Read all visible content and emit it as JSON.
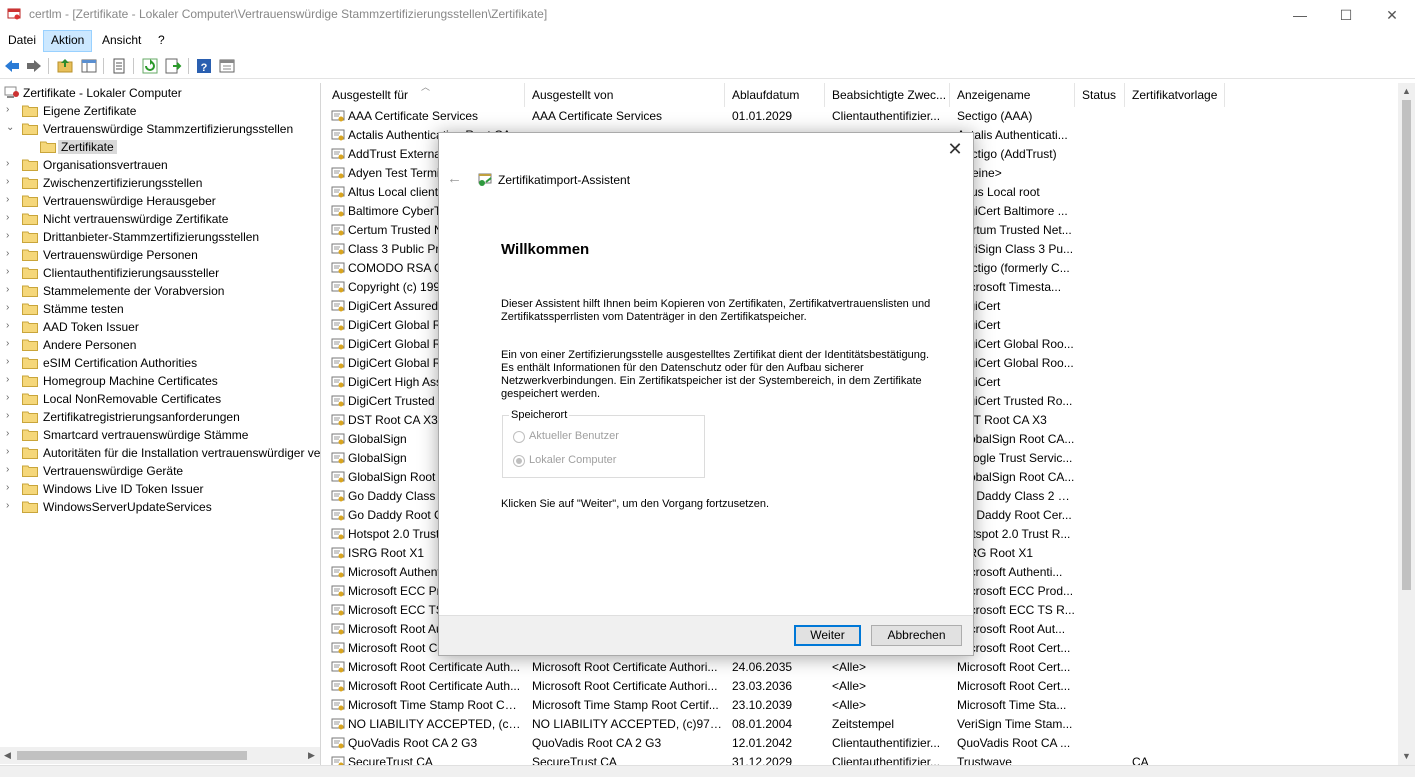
{
  "window": {
    "title": "certlm - [Zertifikate - Lokaler Computer\\Vertrauenswürdige Stammzertifizierungsstellen\\Zertifikate]",
    "minimize": "—",
    "maximize": "☐",
    "close": "✕"
  },
  "menu": [
    "Datei",
    "Aktion",
    "Ansicht",
    "?"
  ],
  "tree": {
    "root": "Zertifikate - Lokaler Computer",
    "items": [
      {
        "label": "Eigene Zertifikate",
        "level": 1,
        "expanded": false
      },
      {
        "label": "Vertrauenswürdige Stammzertifizierungsstellen",
        "level": 1,
        "expanded": true
      },
      {
        "label": "Zertifikate",
        "level": 2,
        "selected": true
      },
      {
        "label": "Organisationsvertrauen",
        "level": 1
      },
      {
        "label": "Zwischenzertifizierungsstellen",
        "level": 1
      },
      {
        "label": "Vertrauenswürdige Herausgeber",
        "level": 1
      },
      {
        "label": "Nicht vertrauenswürdige Zertifikate",
        "level": 1
      },
      {
        "label": "Drittanbieter-Stammzertifizierungsstellen",
        "level": 1
      },
      {
        "label": "Vertrauenswürdige Personen",
        "level": 1
      },
      {
        "label": "Clientauthentifizierungsaussteller",
        "level": 1
      },
      {
        "label": "Stammelemente der Vorabversion",
        "level": 1
      },
      {
        "label": "Stämme testen",
        "level": 1
      },
      {
        "label": "AAD Token Issuer",
        "level": 1
      },
      {
        "label": "Andere Personen",
        "level": 1
      },
      {
        "label": "eSIM Certification Authorities",
        "level": 1
      },
      {
        "label": "Homegroup Machine Certificates",
        "level": 1
      },
      {
        "label": "Local NonRemovable Certificates",
        "level": 1
      },
      {
        "label": "Zertifikatregistrierungsanforderungen",
        "level": 1
      },
      {
        "label": "Smartcard vertrauenswürdige Stämme",
        "level": 1
      },
      {
        "label": "Autoritäten für die Installation vertrauenswürdiger ve",
        "level": 1
      },
      {
        "label": "Vertrauenswürdige Geräte",
        "level": 1
      },
      {
        "label": "Windows Live ID Token Issuer",
        "level": 1
      },
      {
        "label": "WindowsServerUpdateServices",
        "level": 1
      }
    ]
  },
  "columns": [
    "Ausgestellt für",
    "Ausgestellt von",
    "Ablaufdatum",
    "Beabsichtigte Zwec...",
    "Anzeigename",
    "Status",
    "Zertifikatvorlage"
  ],
  "rows": [
    [
      "AAA Certificate Services",
      "AAA Certificate Services",
      "01.01.2029",
      "Clientauthentifizier...",
      "Sectigo (AAA)",
      "",
      ""
    ],
    [
      "Actalis Authentication Root CA",
      "",
      "",
      "",
      "Actalis Authenticati...",
      "",
      ""
    ],
    [
      "AddTrust External CA Root",
      "",
      "",
      "",
      "Sectigo (AddTrust)",
      "",
      ""
    ],
    [
      "Adyen Test Terminal",
      "",
      "",
      "",
      "<Keine>",
      "",
      ""
    ],
    [
      "Altus Local client",
      "",
      "",
      "",
      "Altus Local root",
      "",
      ""
    ],
    [
      "Baltimore CyberTrust",
      "",
      "",
      "",
      "DigiCert Baltimore ...",
      "",
      ""
    ],
    [
      "Certum Trusted Network",
      "",
      "",
      "",
      "Certum Trusted Net...",
      "",
      ""
    ],
    [
      "Class 3 Public Primary",
      "",
      "",
      "",
      "VeriSign Class 3 Pu...",
      "",
      ""
    ],
    [
      "COMODO RSA Certification",
      "",
      "",
      "",
      "Sectigo (formerly C...",
      "",
      ""
    ],
    [
      "Copyright (c) 1997",
      "",
      "",
      "",
      "Microsoft Timesta...",
      "",
      ""
    ],
    [
      "DigiCert Assured",
      "",
      "",
      "",
      "DigiCert",
      "",
      ""
    ],
    [
      "DigiCert Global Root",
      "",
      "",
      "",
      "DigiCert",
      "",
      ""
    ],
    [
      "DigiCert Global Root",
      "",
      "",
      "",
      "DigiCert Global Roo...",
      "",
      ""
    ],
    [
      "DigiCert Global Root",
      "",
      "",
      "",
      "DigiCert Global Roo...",
      "",
      ""
    ],
    [
      "DigiCert High Assurance",
      "",
      "",
      "",
      "DigiCert",
      "",
      ""
    ],
    [
      "DigiCert Trusted Root",
      "",
      "",
      "",
      "DigiCert Trusted Ro...",
      "",
      ""
    ],
    [
      "DST Root CA X3",
      "",
      "",
      "",
      "DST Root CA X3",
      "",
      ""
    ],
    [
      "GlobalSign",
      "",
      "",
      "",
      "GlobalSign Root CA...",
      "",
      ""
    ],
    [
      "GlobalSign",
      "",
      "",
      "",
      "Google Trust Servic...",
      "",
      ""
    ],
    [
      "GlobalSign Root CA",
      "",
      "",
      "",
      "GlobalSign Root CA...",
      "",
      ""
    ],
    [
      "Go Daddy Class 2",
      "",
      "",
      "",
      "Go Daddy Class 2 C...",
      "",
      ""
    ],
    [
      "Go Daddy Root Certificate",
      "",
      "",
      "",
      "Go Daddy Root Cer...",
      "",
      ""
    ],
    [
      "Hotspot 2.0 Trust",
      "",
      "",
      "",
      "Hotspot 2.0 Trust R...",
      "",
      ""
    ],
    [
      "ISRG Root X1",
      "",
      "",
      "",
      "ISRG Root X1",
      "",
      ""
    ],
    [
      "Microsoft Authenticode",
      "",
      "",
      "",
      "Microsoft Authenti...",
      "",
      ""
    ],
    [
      "Microsoft ECC Product",
      "",
      "",
      "",
      "Microsoft ECC Prod...",
      "",
      ""
    ],
    [
      "Microsoft ECC TS",
      "",
      "",
      "",
      "Microsoft ECC TS R...",
      "",
      ""
    ],
    [
      "Microsoft Root Authority",
      "",
      "",
      "",
      "Microsoft Root Aut...",
      "",
      ""
    ],
    [
      "Microsoft Root Certificate",
      "",
      "",
      "",
      "Microsoft Root Cert...",
      "",
      ""
    ],
    [
      "Microsoft Root Certificate Auth...",
      "Microsoft Root Certificate Authori...",
      "24.06.2035",
      "<Alle>",
      "Microsoft Root Cert...",
      "",
      ""
    ],
    [
      "Microsoft Root Certificate Auth...",
      "Microsoft Root Certificate Authori...",
      "23.03.2036",
      "<Alle>",
      "Microsoft Root Cert...",
      "",
      ""
    ],
    [
      "Microsoft Time Stamp Root Cer...",
      "Microsoft Time Stamp Root Certif...",
      "23.10.2039",
      "<Alle>",
      "Microsoft Time Sta...",
      "",
      ""
    ],
    [
      "NO LIABILITY ACCEPTED, (c)97 ...",
      "NO LIABILITY ACCEPTED, (c)97 Ve...",
      "08.01.2004",
      "Zeitstempel",
      "VeriSign Time Stam...",
      "",
      ""
    ],
    [
      "QuoVadis Root CA 2 G3",
      "QuoVadis Root CA 2 G3",
      "12.01.2042",
      "Clientauthentifizier...",
      "QuoVadis Root CA ...",
      "",
      ""
    ],
    [
      "SecureTrust CA",
      "SecureTrust CA",
      "31.12.2029",
      "Clientauthentifizier...",
      "Trustwave",
      "",
      "CA"
    ]
  ],
  "dialog": {
    "title": "Zertifikatimport-Assistent",
    "heading": "Willkommen",
    "para1": "Dieser Assistent hilft Ihnen beim Kopieren von Zertifikaten, Zertifikatvertrauenslisten und Zertifikatssperrlisten vom Datenträger in den Zertifikatspeicher.",
    "para2": "Ein von einer Zertifizierungsstelle ausgestelltes Zertifikat dient der Identitätsbestätigung. Es enthält Informationen für den Datenschutz oder für den Aufbau sicherer Netzwerkverbindungen. Ein Zertifikatspeicher ist der Systembereich, in dem Zertifikate gespeichert werden.",
    "group_label": "Speicherort",
    "option_user": "Aktueller Benutzer",
    "option_machine": "Lokaler Computer",
    "selected_option": "Lokaler Computer",
    "para3": "Klicken Sie auf \"Weiter\", um den Vorgang fortzusetzen.",
    "next_button": "Weiter",
    "cancel_button": "Abbrechen"
  }
}
